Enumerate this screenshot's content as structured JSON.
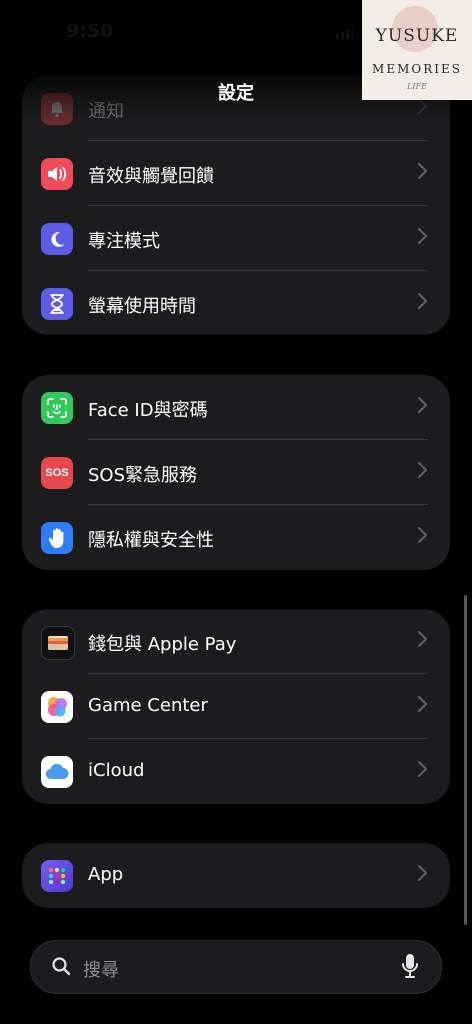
{
  "status_bar": {
    "time": "9:50"
  },
  "nav": {
    "title": "設定"
  },
  "groups": [
    {
      "rows": [
        {
          "label": "通知",
          "icon": "bell-icon",
          "color": "#e5484d"
        },
        {
          "label": "音效與觸覺回饋",
          "icon": "speaker-icon",
          "color": "#ef4b5b"
        },
        {
          "label": "專注模式",
          "icon": "moon-icon",
          "color": "#5e5ce6"
        },
        {
          "label": "螢幕使用時間",
          "icon": "hourglass-icon",
          "color": "#5e5ce6"
        }
      ]
    },
    {
      "rows": [
        {
          "label": "Face ID與密碼",
          "icon": "face-id-icon",
          "color": "#34c759"
        },
        {
          "label": "SOS緊急服務",
          "icon": "sos-icon",
          "color": "#e5484d",
          "icon_text": "SOS"
        },
        {
          "label": "隱私權與安全性",
          "icon": "hand-icon",
          "color": "#2f7cf6"
        }
      ]
    },
    {
      "rows": [
        {
          "label": "錢包與 Apple Pay",
          "icon": "wallet-icon",
          "color": "#1c1c1e"
        },
        {
          "label": "Game Center",
          "icon": "game-center-icon",
          "color": "#ffffff"
        },
        {
          "label": "iCloud",
          "icon": "icloud-icon",
          "color": "#ffffff"
        }
      ]
    },
    {
      "rows": [
        {
          "label": "App",
          "icon": "apps-grid-icon",
          "color": "#6a4de0"
        }
      ]
    }
  ],
  "search": {
    "placeholder": "搜尋"
  },
  "watermark": {
    "line1": "YUSUKE",
    "line2": "MEMORIES",
    "line3": "LIFE"
  }
}
